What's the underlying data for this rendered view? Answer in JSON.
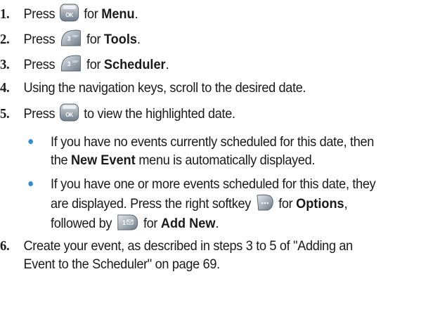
{
  "steps": [
    {
      "num": "1.",
      "pre": "Press",
      "key": "ok-key-icon",
      "mid": "for",
      "bold": "Menu",
      "post": "."
    },
    {
      "num": "2.",
      "pre": "Press",
      "key": "3-def-key-icon",
      "mid": "for",
      "bold": "Tools",
      "post": "."
    },
    {
      "num": "3.",
      "pre": "Press",
      "key": "3-def-key-icon",
      "mid": "for",
      "bold": "Scheduler",
      "post": "."
    },
    {
      "num": "4.",
      "text": "Using the navigation keys, scroll to the desired date."
    },
    {
      "num": "5.",
      "pre": "Press",
      "key": "ok-key-icon",
      "text": "to view the highlighted date."
    },
    {
      "num": "6.",
      "line1": "Create your event, as described in steps 3 to 5 of \"Adding an",
      "line2": "Event to the Scheduler\" on page 69."
    }
  ],
  "bullets": [
    {
      "line1": "If you have no events currently scheduled for this date, then",
      "pre2": "the",
      "bold": "New Event",
      "post2": "menu is automatically displayed."
    },
    {
      "line1": "If you have one or more events scheduled for this date, they",
      "line2a": "are displayed. Press the right softkey",
      "key1": "right-softkey-icon",
      "mid": "for",
      "bold1": "Options",
      "comma": ",",
      "line3a": "followed by",
      "key2": "1-voicemail-key-icon",
      "for2": "for",
      "bold2": "Add New",
      "end": "."
    }
  ],
  "colors": {
    "bullet": "#2f8fd6",
    "text": "#1a1a1a",
    "key_face": "#8d9aa8"
  }
}
